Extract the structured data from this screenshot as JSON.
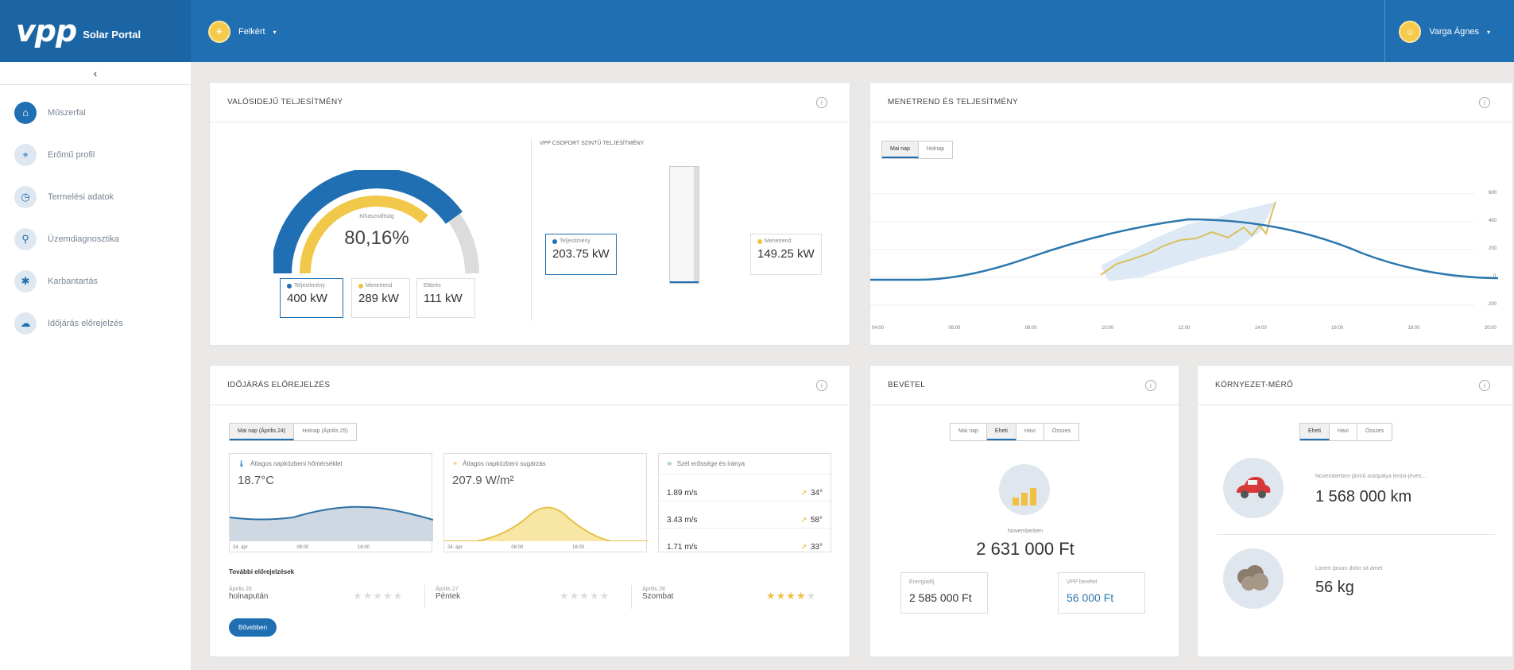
{
  "header": {
    "logo": "vpp",
    "logo_sub": "Solar Portal",
    "site_name": "Felkért",
    "user_name": "Varga Ágnes"
  },
  "sidebar": {
    "collapse_icon": "‹",
    "items": [
      {
        "label": "Műszerfal",
        "icon": "dashboard-icon"
      },
      {
        "label": "Erőmű profil",
        "icon": "plant-profile-icon"
      },
      {
        "label": "Termelési adatok",
        "icon": "clock-icon"
      },
      {
        "label": "Üzemdiagnosztika",
        "icon": "diagnostics-icon"
      },
      {
        "label": "Karbantartás",
        "icon": "maintenance-icon"
      },
      {
        "label": "Időjárás előrejelzés",
        "icon": "weather-icon"
      }
    ]
  },
  "realtime": {
    "title": "VALÓSIDEJŰ TELJESÍTMÉNY",
    "gauge_label": "Kihasználtság",
    "gauge_value": "80,16%",
    "gauge_fraction": 0.8016,
    "boxes": [
      {
        "label": "Teljesítmény",
        "value": "400 kW"
      },
      {
        "label": "Menetrend",
        "value": "289 kW"
      },
      {
        "label": "Eltérés",
        "value": "111 kW"
      }
    ],
    "group_title": "VPP CSOPORT SZINTŰ TELJESÍTMÉNY",
    "group_perf_label": "Teljesítmény",
    "group_perf_value": "203.75 kW",
    "group_sched_label": "Menetrend",
    "group_sched_value": "149.25 kW"
  },
  "schedule": {
    "title": "MENETREND ÉS TELJESÍTMÉNY",
    "tabs": [
      "Mai nap",
      "Holnap"
    ],
    "y_ticks": [
      "600",
      "400",
      "200",
      "0",
      "-200"
    ],
    "x_ticks": [
      "04:00",
      "06:00",
      "08:00",
      "10:00",
      "12:00",
      "14:00",
      "16:00",
      "18:00",
      "20:00"
    ]
  },
  "weather": {
    "title": "IDŐJÁRÁS ELŐREJELZÉS",
    "tabs": [
      "Mai nap (Április 24)",
      "Holnap (Április 25)"
    ],
    "temp_title": "Átlagos napközbeni hőmérséklet",
    "temp_value": "18.7°C",
    "rad_title": "Átlagos napközbeni sugárzás",
    "rad_value": "207.9 W/m²",
    "mini_ticks": [
      "24. ápr",
      "08:00",
      "16:00"
    ],
    "wind_title": "Szél erőssége és iránya",
    "wind": [
      {
        "speed": "1.89 m/s",
        "dir": "34°"
      },
      {
        "speed": "3.43 m/s",
        "dir": "58°"
      },
      {
        "speed": "1.71 m/s",
        "dir": "33°"
      }
    ],
    "more_title": "További előrejelzések",
    "forecast": [
      {
        "date": "Április 26",
        "day": "holnapután"
      },
      {
        "date": "Április 27",
        "day": "Péntek"
      },
      {
        "date": "Április 28",
        "day": "Szombat"
      }
    ],
    "more_button": "Bővebben"
  },
  "revenue": {
    "title": "BEVÉTEL",
    "tabs": [
      "Mai nap",
      "Eheti",
      "Havi",
      "Összes"
    ],
    "caption": "Novemberben",
    "total": "2 631 000 Ft",
    "energy_label": "Energiadíj",
    "energy_value": "2 585 000 Ft",
    "vpp_label": "VPP bevétel",
    "vpp_value": "56 000 Ft"
  },
  "environment": {
    "title": "KÖRNYEZET-MÉRŐ",
    "tabs": [
      "Eheti",
      "Havi",
      "Összes"
    ],
    "car_caption": "Novemberben jármű autópálya lerövi-jéven...",
    "car_value": "1 568 000 km",
    "co2_caption": "Lorem ipsum dolor sit amet",
    "co2_value": "56 kg"
  },
  "colors": {
    "brand": "#1f6fb2",
    "sun": "#f0c040"
  }
}
